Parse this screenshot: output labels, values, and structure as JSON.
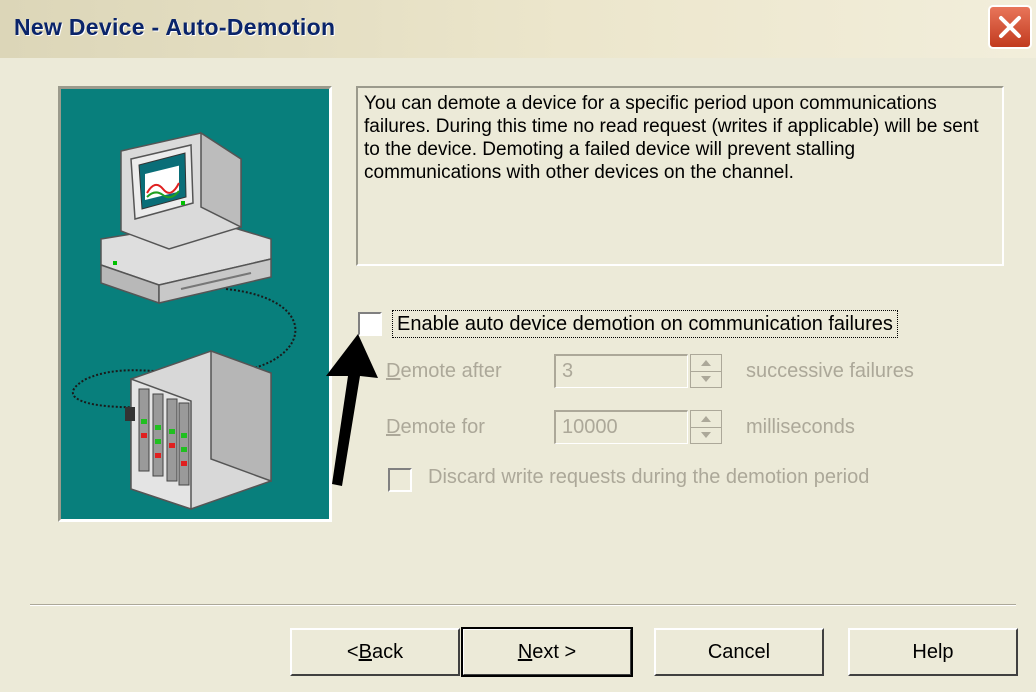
{
  "window": {
    "title": "New Device - Auto-Demotion"
  },
  "description": "You can demote a device for a specific period upon communications failures. During this time no read request (writes if applicable) will be sent to the device. Demoting a failed device will prevent stalling communications with other devices on the channel.",
  "enable_checkbox": {
    "label": "Enable auto device demotion on communication failures",
    "checked": false
  },
  "demote_after": {
    "label_first": "D",
    "label_rest": "emote after",
    "value": "3",
    "suffix": "successive failures"
  },
  "demote_for": {
    "label_first": "D",
    "label_rest": "emote for",
    "value": "10000",
    "suffix": "milliseconds"
  },
  "discard_checkbox": {
    "label": "Discard write requests during the demotion period",
    "checked": false
  },
  "buttons": {
    "back_prefix": "< ",
    "back_key": "B",
    "back_rest": "ack",
    "next_key": "N",
    "next_rest": "ext >",
    "cancel": "Cancel",
    "help": "Help"
  },
  "colors": {
    "title_text": "#0a246a",
    "picture_bg": "#087f7c",
    "dialog_bg": "#ecead8",
    "disabled_text": "#aca899"
  },
  "icons": [
    "close-icon",
    "computer-illustration",
    "device-rack-illustration",
    "arrow-annotation-icon",
    "spin-up-icon",
    "spin-down-icon"
  ]
}
